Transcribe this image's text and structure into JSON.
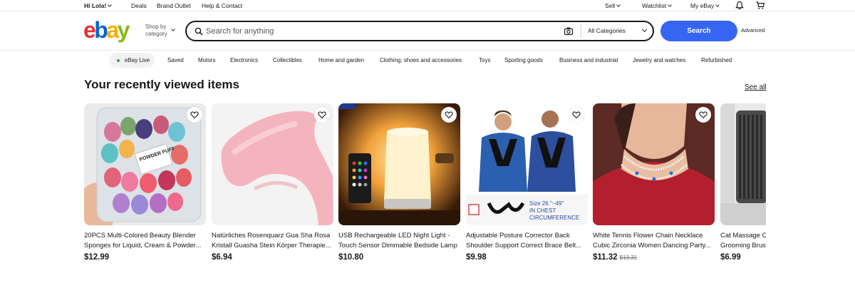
{
  "topbar": {
    "greeting": "Hi Lola!",
    "deals": "Deals",
    "brand_outlet": "Brand Outlet",
    "help": "Help & Contact",
    "sell": "Sell",
    "watchlist": "Watchlist",
    "my_ebay": "My eBay"
  },
  "header": {
    "logo": {
      "e": "e",
      "b": "b",
      "a": "a",
      "y": "y"
    },
    "shop_by_line1": "Shop by",
    "shop_by_line2": "category",
    "search_placeholder": "Search for anything",
    "category_select": "All Categories",
    "search_button": "Search",
    "advanced": "Advanced"
  },
  "nav": {
    "live": "eBay Live",
    "links": [
      "Saved",
      "Motors",
      "Electronics",
      "Collectibles",
      "Home and garden",
      "Clothing, shoes and accessories",
      "Toys",
      "Sporting goods",
      "Business and industrial",
      "Jewelry and watches",
      "Refurbished"
    ]
  },
  "recent": {
    "title": "Your recently viewed items",
    "see_all": "See all",
    "items": [
      {
        "line1": "20PCS Multi-Colored Beauty Blender",
        "line2": "Sponges for Liquid, Cream & Powder...",
        "price": "$12.99",
        "old_price": ""
      },
      {
        "line1": "Natürliches Rosenquarz Gua Sha Rosa",
        "line2": "Kristall Guasha Stein Körper Therapie...",
        "price": "$6.94",
        "old_price": ""
      },
      {
        "line1": "USB Rechargeable LED Night Light -",
        "line2": "Touch Sensor Dimmable Bedside Lamp",
        "price": "$10.80",
        "old_price": ""
      },
      {
        "line1": "Adjustable Posture Corrector Back",
        "line2": "Shoulder Support Correct Brace Belt...",
        "price": "$9.98",
        "old_price": ""
      },
      {
        "line1": "White Tennis Flower Chain Necklace",
        "line2": "Cubic Zirconia Women Dancing Party...",
        "price": "$11.32",
        "old_price": "$13.31"
      },
      {
        "line1": "Cat Massage C",
        "line2": "Grooming Brus",
        "price": "$6.99",
        "old_price": ""
      }
    ],
    "image_text": {
      "puff": "POWDER PUFF",
      "size_line1": "Size 26 \"~49\"",
      "size_line2": "IN CHEST",
      "size_line3": "CIRCUMFERENCE"
    }
  },
  "colors": {
    "search_button": "#3665f3",
    "logo_e": "#e53238",
    "logo_b": "#0064d2",
    "logo_a": "#f5af02",
    "logo_y": "#86b817",
    "live_dot": "#2aa84a"
  }
}
